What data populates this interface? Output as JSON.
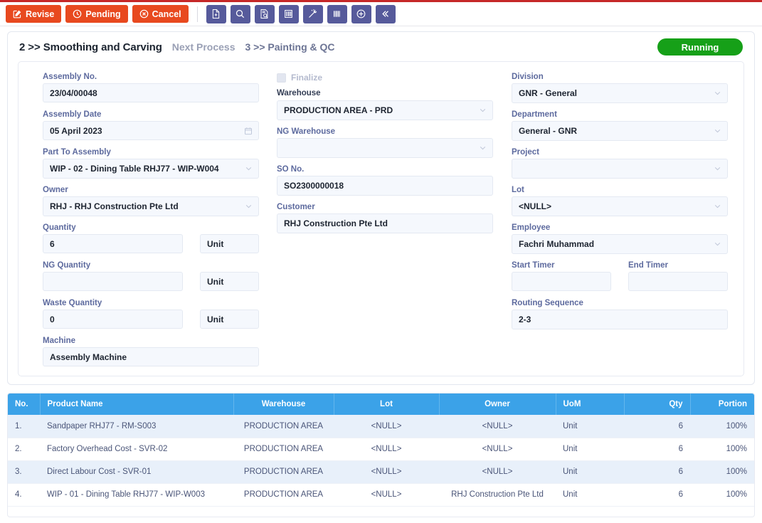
{
  "toolbar": {
    "buttons": [
      {
        "label": "Revise",
        "icon": "edit-square-icon"
      },
      {
        "label": "Pending",
        "icon": "clock-icon"
      },
      {
        "label": "Cancel",
        "icon": "cancel-circle-icon"
      }
    ],
    "icon_buttons": [
      {
        "name": "new-document-icon"
      },
      {
        "name": "search-icon"
      },
      {
        "name": "document-search-icon"
      },
      {
        "name": "barcode-book-icon"
      },
      {
        "name": "magic-wand-icon"
      },
      {
        "name": "barcode-icon"
      },
      {
        "name": "plus-circle-icon"
      },
      {
        "name": "collapse-left-icon"
      }
    ]
  },
  "header": {
    "current_process": "2 >> Smoothing and Carving",
    "next_process_label": "Next Process",
    "next_process": "3 >> Painting & QC",
    "status": "Running"
  },
  "form": {
    "left": {
      "assembly_no_label": "Assembly No.",
      "assembly_no_value": "23/04/00048",
      "assembly_date_label": "Assembly Date",
      "assembly_date_value": "05 April 2023",
      "part_to_assembly_label": "Part To Assembly",
      "part_to_assembly_value": "WIP - 02 - Dining Table RHJ77 - WIP-W004",
      "owner_label": "Owner",
      "owner_value": "RHJ - RHJ Construction Pte Ltd",
      "quantity_label": "Quantity",
      "quantity_value": "6",
      "quantity_uom": "Unit",
      "ng_quantity_label": "NG Quantity",
      "ng_quantity_value": "",
      "ng_quantity_uom": "Unit",
      "waste_quantity_label": "Waste Quantity",
      "waste_quantity_value": "0",
      "waste_quantity_uom": "Unit",
      "machine_label": "Machine",
      "machine_value": "Assembly Machine"
    },
    "middle": {
      "finalize_label": "Finalize",
      "warehouse_label": "Warehouse",
      "warehouse_value": "PRODUCTION AREA - PRD",
      "ng_warehouse_label": "NG Warehouse",
      "ng_warehouse_value": "",
      "so_no_label": "SO No.",
      "so_no_value": "SO2300000018",
      "customer_label": "Customer",
      "customer_value": "RHJ Construction Pte Ltd"
    },
    "right": {
      "division_label": "Division",
      "division_value": "GNR - General",
      "department_label": "Department",
      "department_value": "General - GNR",
      "project_label": "Project",
      "project_value": "",
      "lot_label": "Lot",
      "lot_value": "<NULL>",
      "employee_label": "Employee",
      "employee_value": "Fachri Muhammad",
      "start_timer_label": "Start Timer",
      "start_timer_value": "",
      "end_timer_label": "End Timer",
      "end_timer_value": "",
      "routing_sequence_label": "Routing Sequence",
      "routing_sequence_value": "2-3"
    }
  },
  "table": {
    "columns": [
      {
        "key": "no",
        "label": "No.",
        "align": "ta-l"
      },
      {
        "key": "product",
        "label": "Product Name",
        "align": "ta-l"
      },
      {
        "key": "wh",
        "label": "Warehouse",
        "align": "ta-c"
      },
      {
        "key": "lot",
        "label": "Lot",
        "align": "ta-c"
      },
      {
        "key": "owner",
        "label": "Owner",
        "align": "ta-c"
      },
      {
        "key": "uom",
        "label": "UoM",
        "align": "ta-l"
      },
      {
        "key": "qty",
        "label": "Qty",
        "align": "ta-r"
      },
      {
        "key": "portion",
        "label": "Portion",
        "align": "ta-r"
      }
    ],
    "rows": [
      {
        "no": "1.",
        "product": "Sandpaper RHJ77 - RM-S003",
        "wh": "PRODUCTION AREA",
        "lot": "<NULL>",
        "owner": "<NULL>",
        "uom": "Unit",
        "qty": "6",
        "portion": "100%"
      },
      {
        "no": "2.",
        "product": "Factory Overhead Cost - SVR-02",
        "wh": "PRODUCTION AREA",
        "lot": "<NULL>",
        "owner": "<NULL>",
        "uom": "Unit",
        "qty": "6",
        "portion": "100%"
      },
      {
        "no": "3.",
        "product": "Direct Labour Cost - SVR-01",
        "wh": "PRODUCTION AREA",
        "lot": "<NULL>",
        "owner": "<NULL>",
        "uom": "Unit",
        "qty": "6",
        "portion": "100%"
      },
      {
        "no": "4.",
        "product": "WIP - 01 - Dining Table RHJ77 - WIP-W003",
        "wh": "PRODUCTION AREA",
        "lot": "<NULL>",
        "owner": "RHJ Construction Pte Ltd",
        "uom": "Unit",
        "qty": "6",
        "portion": "100%"
      }
    ]
  },
  "colors": {
    "danger": "#e8491f",
    "icon_button": "#565a9b",
    "status_green": "#16a018",
    "table_header": "#3ba2e8",
    "label": "#5d6a9e",
    "top_rule": "#c62828"
  }
}
